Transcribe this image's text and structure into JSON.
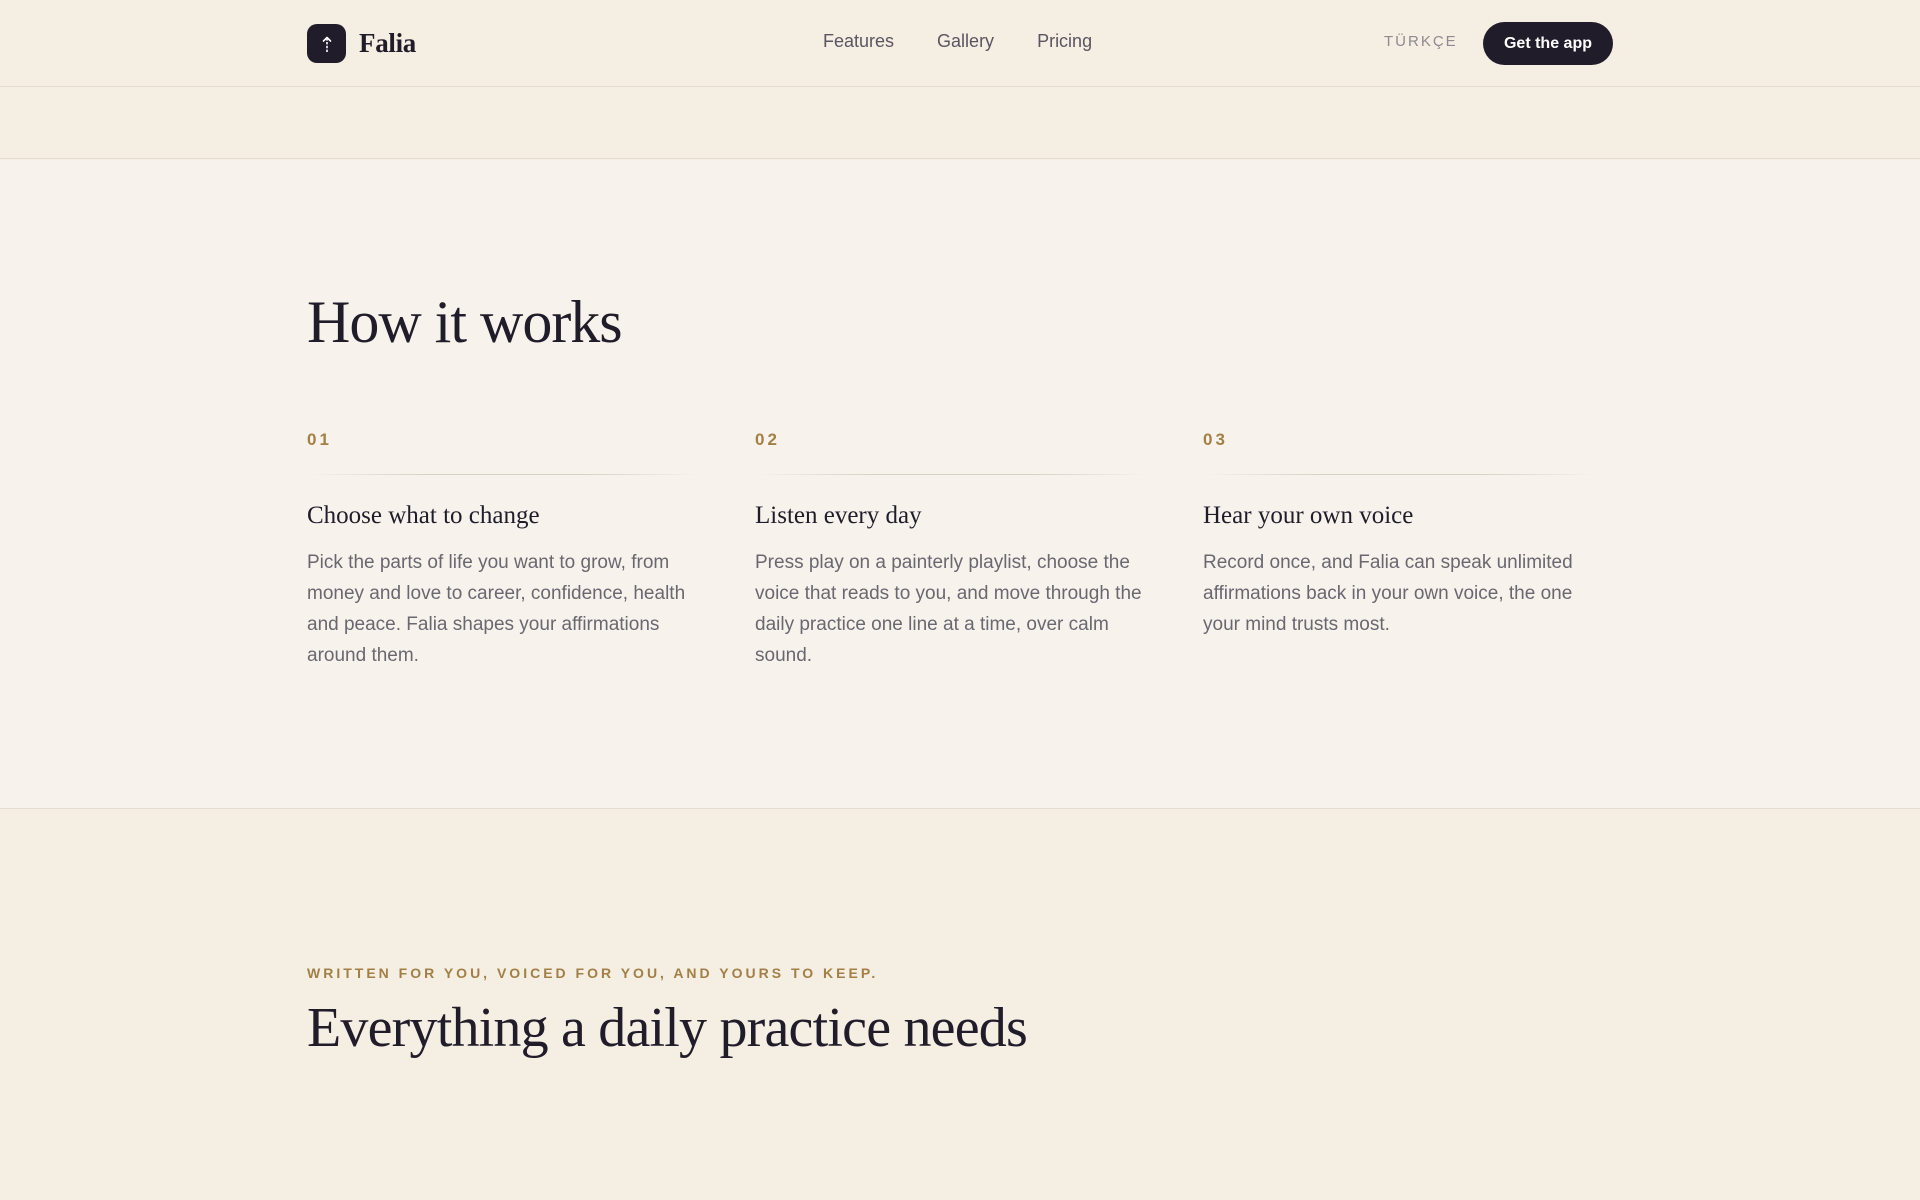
{
  "header": {
    "brand_name": "Falia",
    "nav_links": [
      "Features",
      "Gallery",
      "Pricing"
    ],
    "language": "TÜRKÇE",
    "cta_label": "Get the app"
  },
  "how_it_works": {
    "title": "How it works",
    "steps": [
      {
        "number": "01",
        "title": "Choose what to change",
        "body": "Pick the parts of life you want to grow, from money and love to career, confidence, health and peace. Falia shapes your affirmations around them."
      },
      {
        "number": "02",
        "title": "Listen every day",
        "body": "Press play on a painterly playlist, choose the voice that reads to you, and move through the daily practice one line at a time, over calm sound."
      },
      {
        "number": "03",
        "title": "Hear your own voice",
        "body": "Record once, and Falia can speak unlimited affirmations back in your own voice, the one your mind trusts most."
      }
    ]
  },
  "features": {
    "eyebrow": "WRITTEN FOR YOU, VOICED FOR YOU, AND YOURS TO KEEP.",
    "title": "Everything a daily practice needs"
  },
  "colors": {
    "background": "#f4eee3",
    "section_background": "#f7f3ec",
    "ink": "#211c2a",
    "accent_gold": "#a37f45",
    "muted_text": "#6b6670"
  },
  "icons": {
    "logo": "arrow-up-icon"
  }
}
